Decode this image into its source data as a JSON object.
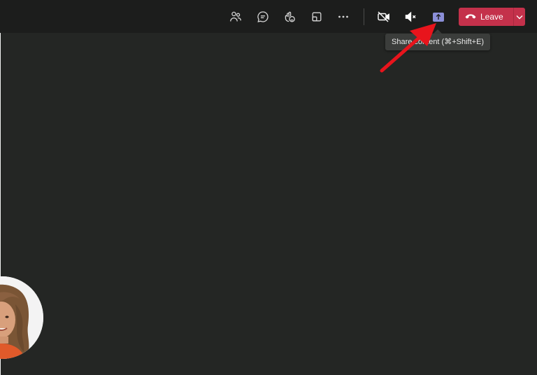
{
  "toolbar": {
    "icons": {
      "people": "people-icon",
      "chat": "chat-icon",
      "reactions": "reactions-icon",
      "rooms": "rooms-icon",
      "more": "more-icon",
      "camera_off": "camera-off-icon",
      "mute": "speaker-mute-icon",
      "share": "share-content-icon"
    },
    "leave_label": "Leave",
    "leave_color": "#c4314b",
    "share_color": "#8b8fd8"
  },
  "tooltip": {
    "text": "Share content (⌘+Shift+E)"
  },
  "annotation": {
    "arrow_color": "#e8141c"
  }
}
